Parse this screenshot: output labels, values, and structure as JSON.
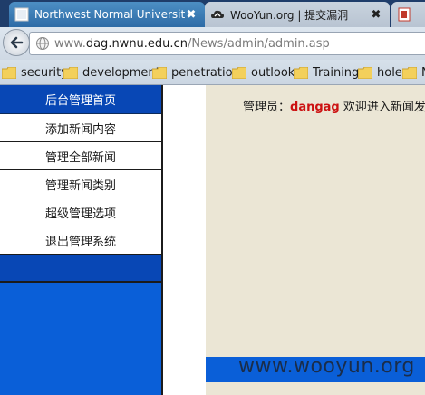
{
  "browser": {
    "tabs": [
      {
        "title": "Northwest Normal University!",
        "close": "✖"
      },
      {
        "title": "WooYun.org | 提交漏洞",
        "close": "✖"
      },
      {
        "title": ""
      }
    ],
    "address_bar": {
      "url_prefix": "www.",
      "url_host": "dag.nwnu.edu.cn",
      "url_path": "/News/admin/admin.asp"
    },
    "bookmarks": [
      "security",
      "development",
      "penetration",
      "outlook",
      "Training",
      "hole",
      "N"
    ]
  },
  "sidebar": {
    "header": "后台管理首页",
    "items": [
      "添加新闻内容",
      "管理全部新闻",
      "管理新闻类别",
      "超级管理选项",
      "退出管理系统"
    ]
  },
  "main": {
    "welcome_prefix": "管理员：",
    "admin_name": "dangag",
    "welcome_suffix": " 欢迎进入新闻发布"
  },
  "watermark": "www.wooyun.org",
  "colors": {
    "tab_bar": "#1f3d6a",
    "sidebar_blue": "#0a5fd8",
    "sidebar_header": "#0847b5",
    "content_bg": "#ebe6d5",
    "admin_name": "#cc1111"
  }
}
